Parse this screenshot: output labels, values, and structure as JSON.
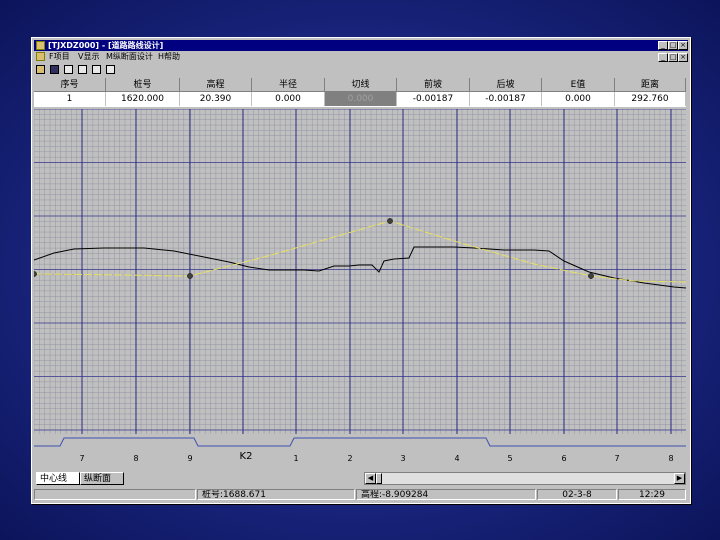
{
  "window": {
    "title": "[TJXDZ000] - [道路路线设计]",
    "caption_buttons": [
      "_",
      "□",
      "×"
    ],
    "mdi_buttons": [
      "_",
      "□",
      "×"
    ]
  },
  "menu": {
    "items": [
      "F项目",
      "V显示",
      "M纵断面设计",
      "H帮助"
    ]
  },
  "toolbar": {
    "icons": [
      "open-icon",
      "save-icon",
      "zoom-in-icon",
      "zoom-out-icon",
      "zoom-fit-icon"
    ]
  },
  "table": {
    "headers": [
      "序号",
      "桩号",
      "高程",
      "半径",
      "切线",
      "前坡",
      "后坡",
      "E值",
      "距离"
    ],
    "row": [
      "1",
      "1620.000",
      "20.390",
      "0.000",
      "0.000",
      "-0.00187",
      "-0.00187",
      "0.000",
      "292.760"
    ],
    "selected_col": 4
  },
  "profile": {
    "x_tick_labels": [
      "7",
      "8",
      "9",
      "K2",
      "1",
      "2",
      "3",
      "4",
      "5",
      "6",
      "7",
      "8"
    ],
    "ground_line_color": "#000000",
    "design_line_color": "#e8e060",
    "marker_color": "#404040"
  },
  "tabs": {
    "items": [
      "中心线",
      "纵断面"
    ],
    "active": 0
  },
  "status": {
    "station": "桩号:1688.671",
    "elevation": "高程:-8.909284",
    "date": "02-3-8",
    "time": "12:29"
  }
}
